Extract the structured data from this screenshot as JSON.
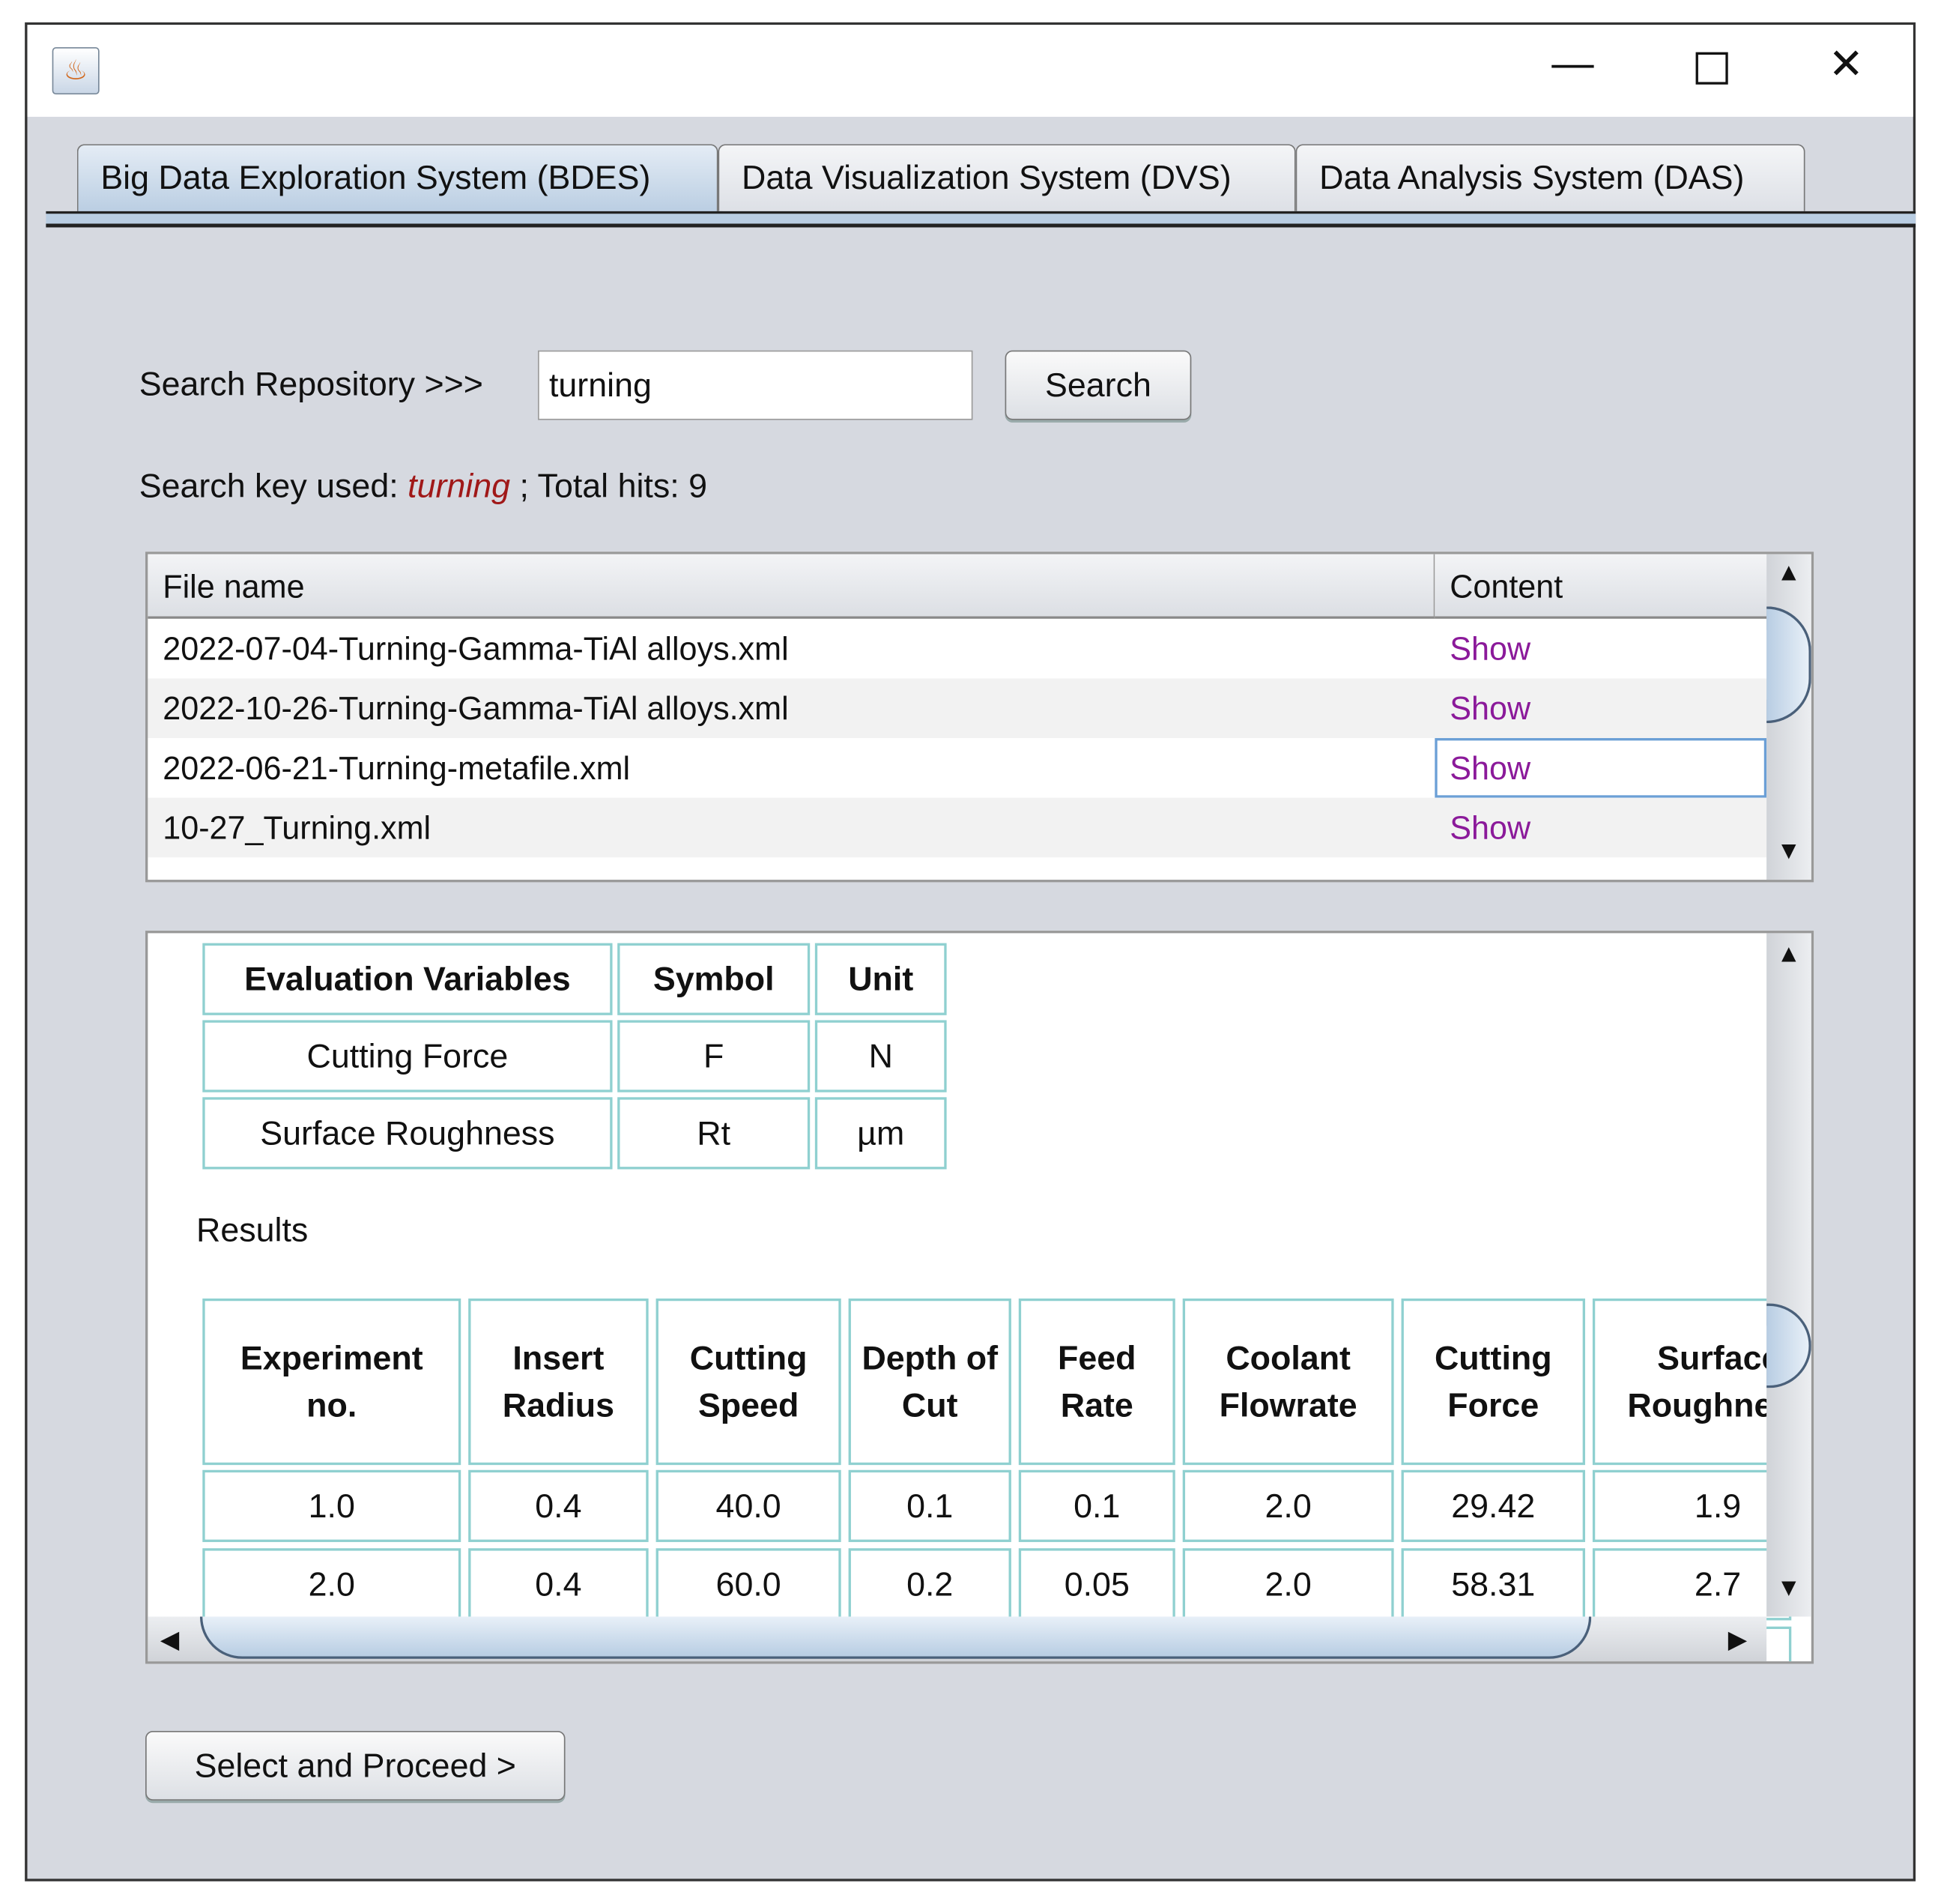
{
  "window": {
    "icon": "java-app-icon",
    "controls": [
      "minimize-icon",
      "maximize-icon",
      "close-icon"
    ]
  },
  "tabs": [
    {
      "label": "Big Data Exploration System (BDES)",
      "active": true
    },
    {
      "label": "Data Visualization System (DVS)"
    },
    {
      "label": "Data Analysis System (DAS)"
    }
  ],
  "search": {
    "label": "Search Repository >>>",
    "value": "turning",
    "button": "Search"
  },
  "status": {
    "prefix": "Search key used: ",
    "key": "turning",
    "suffix": " ; Total hits: 9",
    "key_color": "#a01818"
  },
  "files": {
    "headers": [
      "File name",
      "Content"
    ],
    "rows": [
      {
        "name": "2022-07-04-Turning-Gamma-TiAl alloys.xml",
        "content": "Show"
      },
      {
        "name": "2022-10-26-Turning-Gamma-TiAl alloys.xml",
        "content": "Show"
      },
      {
        "name": "2022-06-21-Turning-metafile.xml",
        "content": "Show",
        "selected": true
      },
      {
        "name": "10-27_Turning.xml",
        "content": "Show"
      }
    ],
    "link_color": "#8b1a9a"
  },
  "eval": {
    "headers": [
      "Evaluation Variables",
      "Symbol",
      "Unit"
    ],
    "rows": [
      [
        "Cutting Force",
        "F",
        "N"
      ],
      [
        "Surface Roughness",
        "Rt",
        "µm"
      ]
    ]
  },
  "results": {
    "title": "Results",
    "headers": [
      "Experiment no.",
      "Insert Radius",
      "Cutting Speed",
      "Depth of Cut",
      "Feed Rate",
      "Coolant Flowrate",
      "Cutting Force",
      "Surface Roughness"
    ],
    "rows": [
      [
        "1.0",
        "0.4",
        "40.0",
        "0.1",
        "0.1",
        "2.0",
        "29.42",
        "1.9"
      ],
      [
        "2.0",
        "0.4",
        "60.0",
        "0.2",
        "0.05",
        "2.0",
        "58.31",
        "2.7"
      ]
    ]
  },
  "proceed_button": "Select and Proceed >"
}
